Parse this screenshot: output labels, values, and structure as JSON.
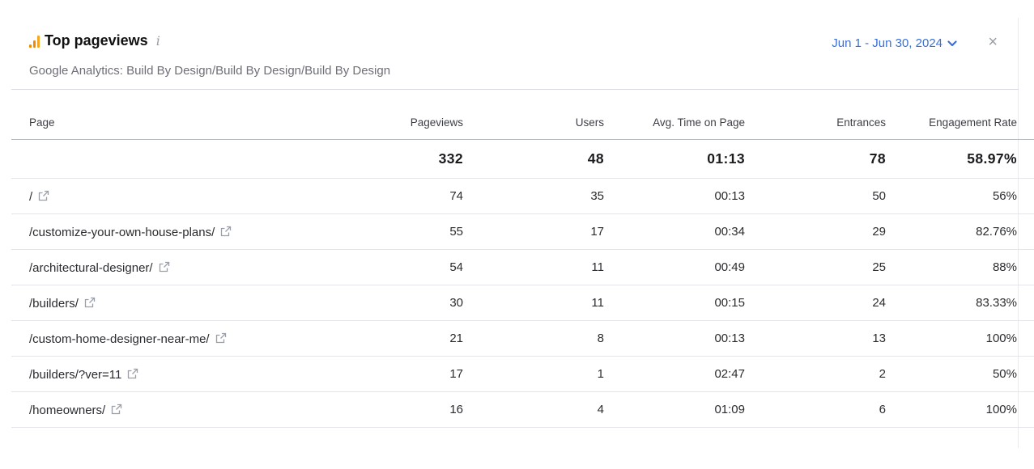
{
  "widget": {
    "title": "Top pageviews",
    "info_icon": "i",
    "subtitle": "Google Analytics: Build By Design/Build By Design/Build By Design",
    "date_range": "Jun 1 - Jun 30, 2024",
    "close_glyph": "×",
    "accent_color": "#f5a623",
    "link_color": "#3a6fd8"
  },
  "table": {
    "columns": [
      "Page",
      "Pageviews",
      "Users",
      "Avg. Time on Page",
      "Entrances",
      "Engagement Rate"
    ],
    "totals": [
      "332",
      "48",
      "01:13",
      "78",
      "58.97%"
    ],
    "rows": [
      {
        "page": "/",
        "pageviews": "74",
        "users": "35",
        "avg_time": "00:13",
        "entrances": "50",
        "engagement": "56%"
      },
      {
        "page": "/customize-your-own-house-plans/",
        "pageviews": "55",
        "users": "17",
        "avg_time": "00:34",
        "entrances": "29",
        "engagement": "82.76%"
      },
      {
        "page": "/architectural-designer/",
        "pageviews": "54",
        "users": "11",
        "avg_time": "00:49",
        "entrances": "25",
        "engagement": "88%"
      },
      {
        "page": "/builders/",
        "pageviews": "30",
        "users": "11",
        "avg_time": "00:15",
        "entrances": "24",
        "engagement": "83.33%"
      },
      {
        "page": "/custom-home-designer-near-me/",
        "pageviews": "21",
        "users": "8",
        "avg_time": "00:13",
        "entrances": "13",
        "engagement": "100%"
      },
      {
        "page": "/builders/?ver=11",
        "pageviews": "17",
        "users": "1",
        "avg_time": "02:47",
        "entrances": "2",
        "engagement": "50%"
      },
      {
        "page": "/homeowners/",
        "pageviews": "16",
        "users": "4",
        "avg_time": "01:09",
        "entrances": "6",
        "engagement": "100%"
      }
    ]
  }
}
